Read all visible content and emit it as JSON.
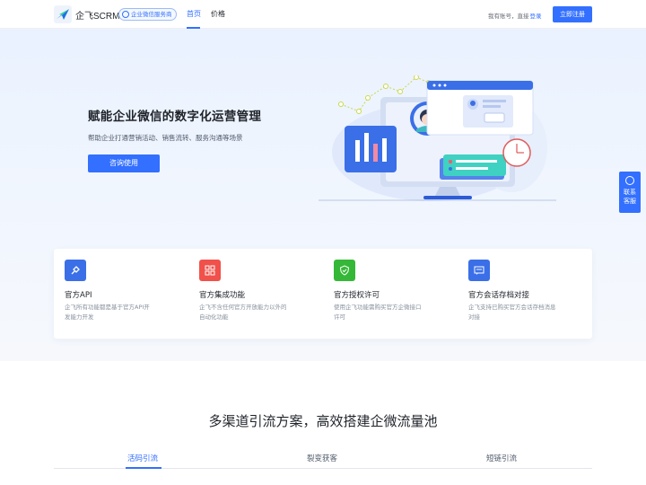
{
  "header": {
    "brand": "企飞SCRM",
    "badge": "企业微信服务商",
    "nav": {
      "home": "首页",
      "price": "价格"
    },
    "has_account": "我有账号，直接",
    "login": "登录",
    "register": "立即注册"
  },
  "hero": {
    "title": "赋能企业微信的数字化运营管理",
    "subtitle": "帮助企业打通营销活动、销售流转、服务沟通等场景",
    "cta": "咨询使用"
  },
  "features": [
    {
      "title": "官方API",
      "desc": "企飞所有功能都是基于官方API开发能力开发",
      "icon": "plug-icon",
      "color": "#3a6fe8"
    },
    {
      "title": "官方集成功能",
      "desc": "企飞不含任何官方开放能力以外的自动化功能",
      "icon": "grid-icon",
      "color": "#f0514a"
    },
    {
      "title": "官方授权许可",
      "desc": "使用企飞功能需购买官方企微接口许可",
      "icon": "shield-check-icon",
      "color": "#35b837"
    },
    {
      "title": "官方会话存档对接",
      "desc": "企飞支持已购买官方会话存档消息对接",
      "icon": "chat-screen-icon",
      "color": "#3a6fe8"
    }
  ],
  "contact": {
    "line1": "联系",
    "line2": "客服",
    "icon": "chat-bubble-icon"
  },
  "section": {
    "title": "多渠道引流方案，高效搭建企微流量池",
    "tabs": [
      "活码引流",
      "裂变获客",
      "短链引流"
    ],
    "active_tab": "活码引流"
  },
  "colors": {
    "primary": "#3370ff",
    "hero_bg": "#eaf2ff"
  }
}
